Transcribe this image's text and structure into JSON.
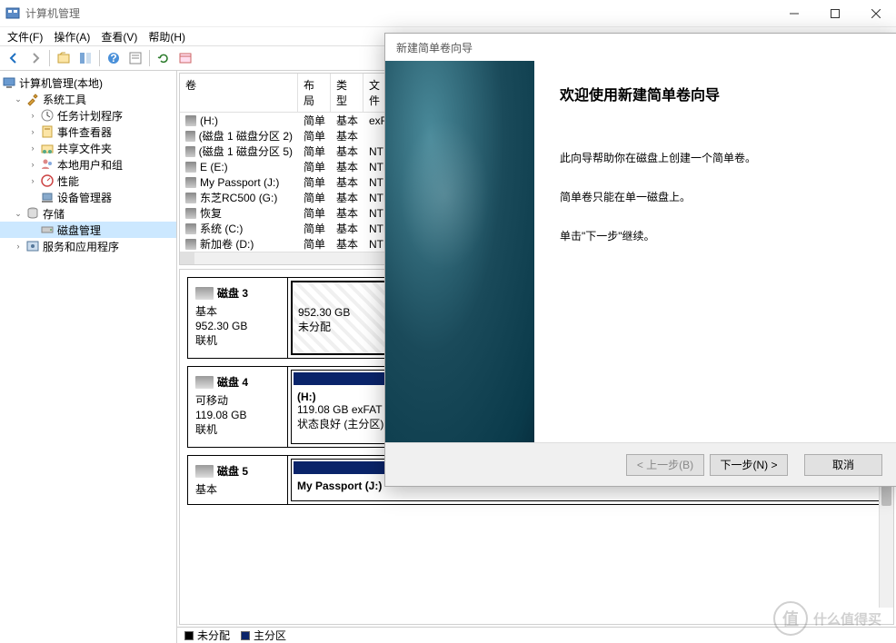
{
  "window": {
    "title": "计算机管理",
    "controls": {
      "min": "—",
      "max": "☐",
      "close": "✕"
    }
  },
  "menu": {
    "file": "文件(F)",
    "action": "操作(A)",
    "view": "查看(V)",
    "help": "帮助(H)"
  },
  "tree": {
    "root": "计算机管理(本地)",
    "systools": "系统工具",
    "task": "任务计划程序",
    "event": "事件查看器",
    "shared": "共享文件夹",
    "users": "本地用户和组",
    "perf": "性能",
    "devmgr": "设备管理器",
    "storage": "存储",
    "diskmgmt": "磁盘管理",
    "services": "服务和应用程序"
  },
  "vol_list": {
    "headers": {
      "vol": "卷",
      "layout": "布局",
      "type": "类型",
      "fs": "文件"
    },
    "rows": [
      {
        "name": "(H:)",
        "layout": "简单",
        "type": "基本",
        "fs": "exFA"
      },
      {
        "name": "(磁盘 1 磁盘分区 2)",
        "layout": "简单",
        "type": "基本",
        "fs": ""
      },
      {
        "name": "(磁盘 1 磁盘分区 5)",
        "layout": "简单",
        "type": "基本",
        "fs": "NTF"
      },
      {
        "name": "E (E:)",
        "layout": "简单",
        "type": "基本",
        "fs": "NTF"
      },
      {
        "name": "My Passport (J:)",
        "layout": "简单",
        "type": "基本",
        "fs": "NTF"
      },
      {
        "name": "东芝RC500 (G:)",
        "layout": "简单",
        "type": "基本",
        "fs": "NTF"
      },
      {
        "name": "恢复",
        "layout": "简单",
        "type": "基本",
        "fs": "NTF"
      },
      {
        "name": "系统 (C:)",
        "layout": "简单",
        "type": "基本",
        "fs": "NTF"
      },
      {
        "name": "新加卷 (D:)",
        "layout": "简单",
        "type": "基本",
        "fs": "NTF"
      }
    ]
  },
  "disks": {
    "d3": {
      "title": "磁盘 3",
      "type": "基本",
      "size": "952.30 GB",
      "status": "联机",
      "part_size": "952.30 GB",
      "part_status": "未分配"
    },
    "d4": {
      "title": "磁盘 4",
      "type": "可移动",
      "size": "119.08 GB",
      "status": "联机",
      "part_name": "(H:)",
      "part_size": "119.08 GB exFAT",
      "part_status": "状态良好 (主分区)"
    },
    "d5": {
      "title": "磁盘 5",
      "type": "基本",
      "part_name": "My Passport  (J:)"
    }
  },
  "legend": {
    "unalloc": "未分配",
    "primary": "主分区"
  },
  "wizard": {
    "title": "新建简单卷向导",
    "heading": "欢迎使用新建简单卷向导",
    "p1": "此向导帮助你在磁盘上创建一个简单卷。",
    "p2": "简单卷只能在单一磁盘上。",
    "p3": "单击\"下一步\"继续。",
    "back": "< 上一步(B)",
    "next": "下一步(N) >",
    "cancel": "取消"
  },
  "watermark": {
    "logo": "值",
    "text": "什么值得买"
  }
}
